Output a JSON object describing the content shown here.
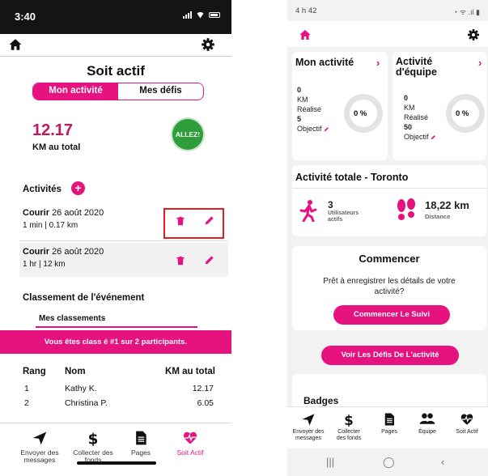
{
  "left": {
    "status": {
      "time": "3:40"
    },
    "title": "Soit actif",
    "segments": [
      "Mon activité",
      "Mes défis"
    ],
    "km_total": "12.17",
    "km_label": "KM au total",
    "allez_label": "ALLEZ!",
    "activities_title": "Activités",
    "activities": [
      {
        "type": "Courir",
        "date": "26 août 2020",
        "details": "1 min | 0.17 km"
      },
      {
        "type": "Courir",
        "date": "26 août 2020",
        "details": "1 hr | 12 km"
      }
    ],
    "classement_title": "Classement de l'événement",
    "mes_classements": "Mes classements",
    "banner": "Vous êtes class é #1 sur 2 participants.",
    "table": {
      "headers": [
        "Rang",
        "Nom",
        "KM au total"
      ],
      "rows": [
        [
          "1",
          "Kathy K.",
          "12.17"
        ],
        [
          "2",
          "Christina P.",
          "6.05"
        ]
      ]
    },
    "tabs": [
      {
        "line1": "Envoyer des",
        "line2": "messages",
        "icon": "send-icon"
      },
      {
        "line1": "Collecter des",
        "line2": "fonds",
        "icon": "dollar-icon"
      },
      {
        "line1": "Pages",
        "line2": "",
        "icon": "page-icon"
      },
      {
        "line1": "Soit Actif",
        "line2": "",
        "icon": "heart-pulse-icon"
      }
    ]
  },
  "right": {
    "status": {
      "time": "4 h 42",
      "right": "◔ ᯤ .ıl ▮"
    },
    "mon_activite": {
      "title": "Mon activité",
      "km_value": "0",
      "km_unit": "KM",
      "realise": "Réalisé",
      "objectif_value": "5",
      "objectif_label": "Objectif",
      "percent": "0 %"
    },
    "equipe": {
      "title_line1": "Activité",
      "title_line2": "d'équipe",
      "km_value": "0",
      "km_unit": "KM",
      "realise": "Réalisé",
      "objectif_value": "50",
      "objectif_label": "Objectif",
      "percent": "0 %"
    },
    "totale": {
      "title": "Activité totale - Toronto",
      "users_value": "3",
      "users_label_1": "Utilisateurs",
      "users_label_2": "actifs",
      "distance_value": "18,22 km",
      "distance_label": "Distance"
    },
    "commencer": {
      "title": "Commencer",
      "text_line1": "Prêt à enregistrer les détails de votre",
      "text_line2": "activité?",
      "button": "Commencer Le Suivi"
    },
    "defis_button": "Voir Les Défis De L'activité",
    "badges_title": "Badges",
    "tabs": [
      {
        "line1": "Envoyer des",
        "line2": "messages",
        "icon": "send-icon"
      },
      {
        "line1": "Collecter",
        "line2": "des fonds",
        "icon": "dollar-icon"
      },
      {
        "line1": "Pages",
        "line2": "",
        "icon": "page-icon"
      },
      {
        "line1": "Équipe",
        "line2": "",
        "icon": "team-icon"
      },
      {
        "line1": "Soit Actif",
        "line2": "",
        "icon": "heart-pulse-icon"
      }
    ],
    "nav": [
      "|||",
      "◯",
      "‹"
    ]
  },
  "colors": {
    "accent": "#e6127f",
    "go_green": "#2e9e3a",
    "highlight_red": "#e01e1e"
  }
}
